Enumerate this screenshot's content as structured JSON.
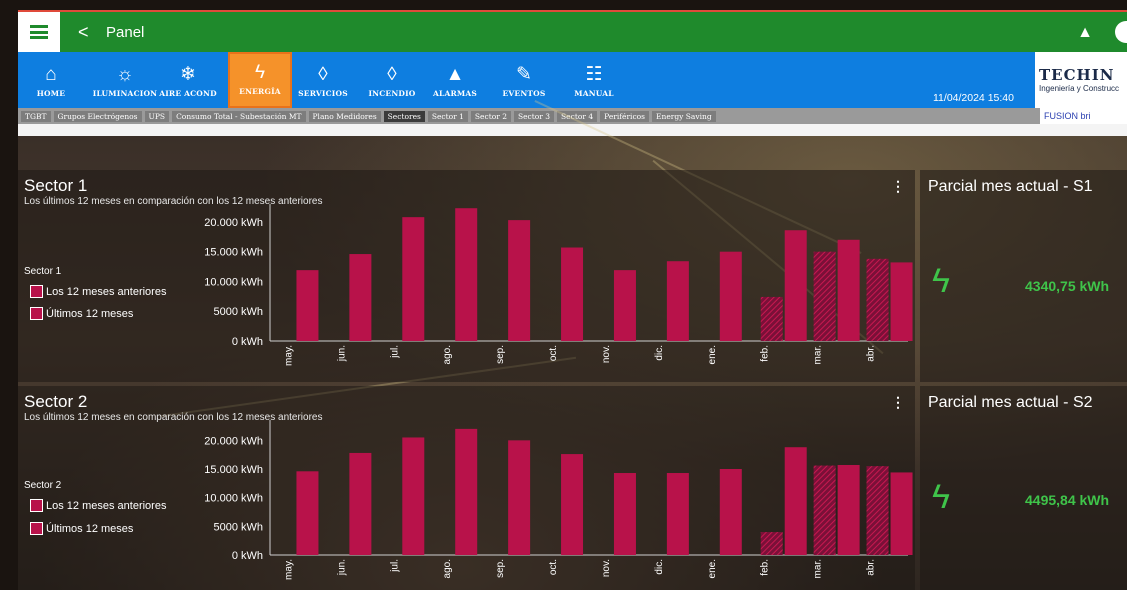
{
  "header": {
    "title": "Panel",
    "menu_icon": "menu-icon",
    "back_icon": "chevron-left-icon",
    "bell_icon": "bell-icon"
  },
  "nav": {
    "items": [
      {
        "label": "HOME",
        "icon": "home-icon",
        "glyph": "⌂"
      },
      {
        "label": "ILUMINACION",
        "icon": "sun-icon",
        "glyph": "☼"
      },
      {
        "label": "AIRE ACOND",
        "icon": "snowflake-icon",
        "glyph": "❄"
      },
      {
        "label": "ENERGÍA",
        "icon": "bolt-icon",
        "glyph": "ϟ"
      },
      {
        "label": "SERVICIOS",
        "icon": "drop-icon",
        "glyph": "◊"
      },
      {
        "label": "INCENDIO",
        "icon": "drop-icon",
        "glyph": "◊"
      },
      {
        "label": "ALARMAS",
        "icon": "bell-icon",
        "glyph": "▲"
      },
      {
        "label": "EVENTOS",
        "icon": "pencil-icon",
        "glyph": "✎"
      },
      {
        "label": "MANUAL",
        "icon": "manual-icon",
        "glyph": "☷"
      }
    ],
    "active_index": 3,
    "datetime": "11/04/2024 15:40",
    "logo": {
      "name": "TECHIN",
      "tagline": "Ingeniería y Construcc"
    }
  },
  "tabs": [
    "TGBT",
    "Grupos Electrógenos",
    "UPS",
    "Consumo Total - Subestación MT",
    "Plano Medidores",
    "Sectores",
    "Sector 1",
    "Sector 2",
    "Sector 3",
    "Sector 4",
    "Periféricos",
    "Energy Saving"
  ],
  "active_tab": "Sectores",
  "fusion_logo": "FUSION bri",
  "colors": {
    "bar": "#b8124a",
    "accent": "#3fc44a",
    "topbar": "#1f8a2c",
    "navbar": "#0e7ee0"
  },
  "sectors": [
    {
      "title": "Sector 1",
      "subtitle": "Los últimos 12 meses en comparación con los 12 meses anteriores",
      "legend_title": "Sector 1",
      "legend": [
        "Los 12 meses anteriores",
        "Últimos 12 meses"
      ],
      "partial_title": "Parcial mes actual - S1",
      "partial_value": "4340,75 kWh"
    },
    {
      "title": "Sector 2",
      "subtitle": "Los últimos 12 meses en comparación con los 12 meses anteriores",
      "legend_title": "Sector 2",
      "legend": [
        "Los 12 meses anteriores",
        "Últimos 12 meses"
      ],
      "partial_title": "Parcial mes actual - S2",
      "partial_value": "4495,84 kWh"
    }
  ],
  "chart_data": [
    {
      "type": "bar",
      "categories": [
        "may.",
        "jun.",
        "jul.",
        "ago.",
        "sep.",
        "oct.",
        "nov.",
        "dic.",
        "ene.",
        "feb.",
        "mar.",
        "abr."
      ],
      "ytick_labels": [
        "0 kWh",
        "5000 kWh",
        "10.000 kWh",
        "15.000 kWh",
        "20.000 kWh"
      ],
      "ylim": [
        0,
        22000
      ],
      "series": [
        {
          "name": "Los 12 meses anteriores",
          "values": [
            null,
            null,
            null,
            null,
            null,
            null,
            null,
            null,
            null,
            7400,
            15000,
            13800
          ]
        },
        {
          "name": "Últimos 12 meses",
          "values": [
            11900,
            14600,
            20800,
            22300,
            20300,
            15700,
            11900,
            13400,
            15000,
            18600,
            17000,
            13200
          ]
        }
      ]
    },
    {
      "type": "bar",
      "categories": [
        "may.",
        "jun.",
        "jul.",
        "ago.",
        "sep.",
        "oct.",
        "nov.",
        "dic.",
        "ene.",
        "feb.",
        "mar.",
        "abr."
      ],
      "ytick_labels": [
        "0 kWh",
        "5000 kWh",
        "10.000 kWh",
        "15.000 kWh",
        "20.000 kWh"
      ],
      "ylim": [
        0,
        22500
      ],
      "series": [
        {
          "name": "Los 12 meses anteriores",
          "values": [
            null,
            null,
            null,
            null,
            null,
            null,
            null,
            null,
            null,
            4000,
            15600,
            15500
          ]
        },
        {
          "name": "Últimos 12 meses",
          "values": [
            14600,
            17800,
            20500,
            22000,
            20000,
            17600,
            14300,
            14300,
            15000,
            18800,
            15700,
            14400
          ]
        }
      ]
    }
  ]
}
